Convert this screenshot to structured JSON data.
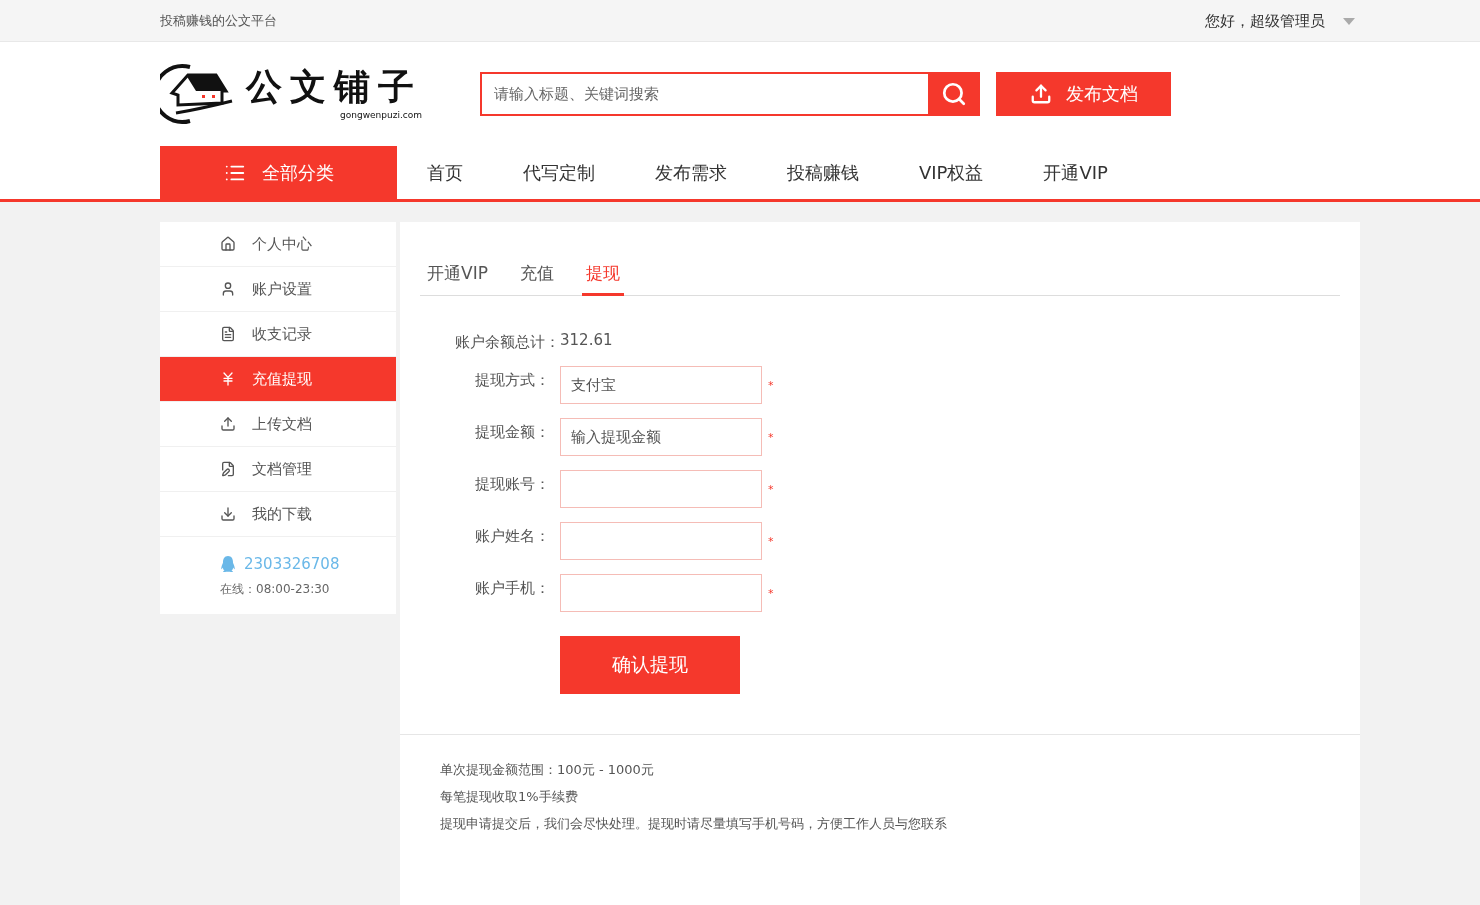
{
  "top_bar": {
    "slogan": "投稿赚钱的公文平台",
    "greeting": "您好，超级管理员"
  },
  "logo": {
    "title": "公文铺子",
    "domain": "gongwenpuzi.com"
  },
  "search": {
    "placeholder": "请输入标题、关键词搜索"
  },
  "publish_button": "发布文档",
  "nav": {
    "category_button": "全部分类",
    "items": [
      "首页",
      "代写定制",
      "发布需求",
      "投稿赚钱",
      "VIP权益",
      "开通VIP"
    ]
  },
  "sidebar": {
    "items": [
      {
        "label": "个人中心",
        "selected": false
      },
      {
        "label": "账户设置",
        "selected": false
      },
      {
        "label": "收支记录",
        "selected": false
      },
      {
        "label": "充值提现",
        "selected": true
      },
      {
        "label": "上传文档",
        "selected": false
      },
      {
        "label": "文档管理",
        "selected": false
      },
      {
        "label": "我的下载",
        "selected": false
      }
    ],
    "qq": "2303326708",
    "hours": "在线：08:00-23:30"
  },
  "tabs": [
    {
      "label": "开通VIP",
      "selected": false
    },
    {
      "label": "充值",
      "selected": false
    },
    {
      "label": "提现",
      "selected": true
    }
  ],
  "balance": {
    "label": "账户余额总计：",
    "value": "312.61"
  },
  "form": {
    "fields": [
      {
        "label": "提现方式：",
        "value": "支付宝",
        "required_mark": "*"
      },
      {
        "label": "提现金额：",
        "placeholder": "输入提现金额",
        "required_mark": "*"
      },
      {
        "label": "提现账号：",
        "required_mark": "*"
      },
      {
        "label": "账户姓名：",
        "required_mark": "*"
      },
      {
        "label": "账户手机：",
        "required_mark": "*"
      }
    ],
    "submit": "确认提现"
  },
  "notes": [
    "单次提现金额范围：100元 - 1000元",
    "每笔提现收取1%手续费",
    "提现申请提交后，我们会尽快处理。提现时请尽量填写手机号码，方便工作人员与您联系"
  ]
}
